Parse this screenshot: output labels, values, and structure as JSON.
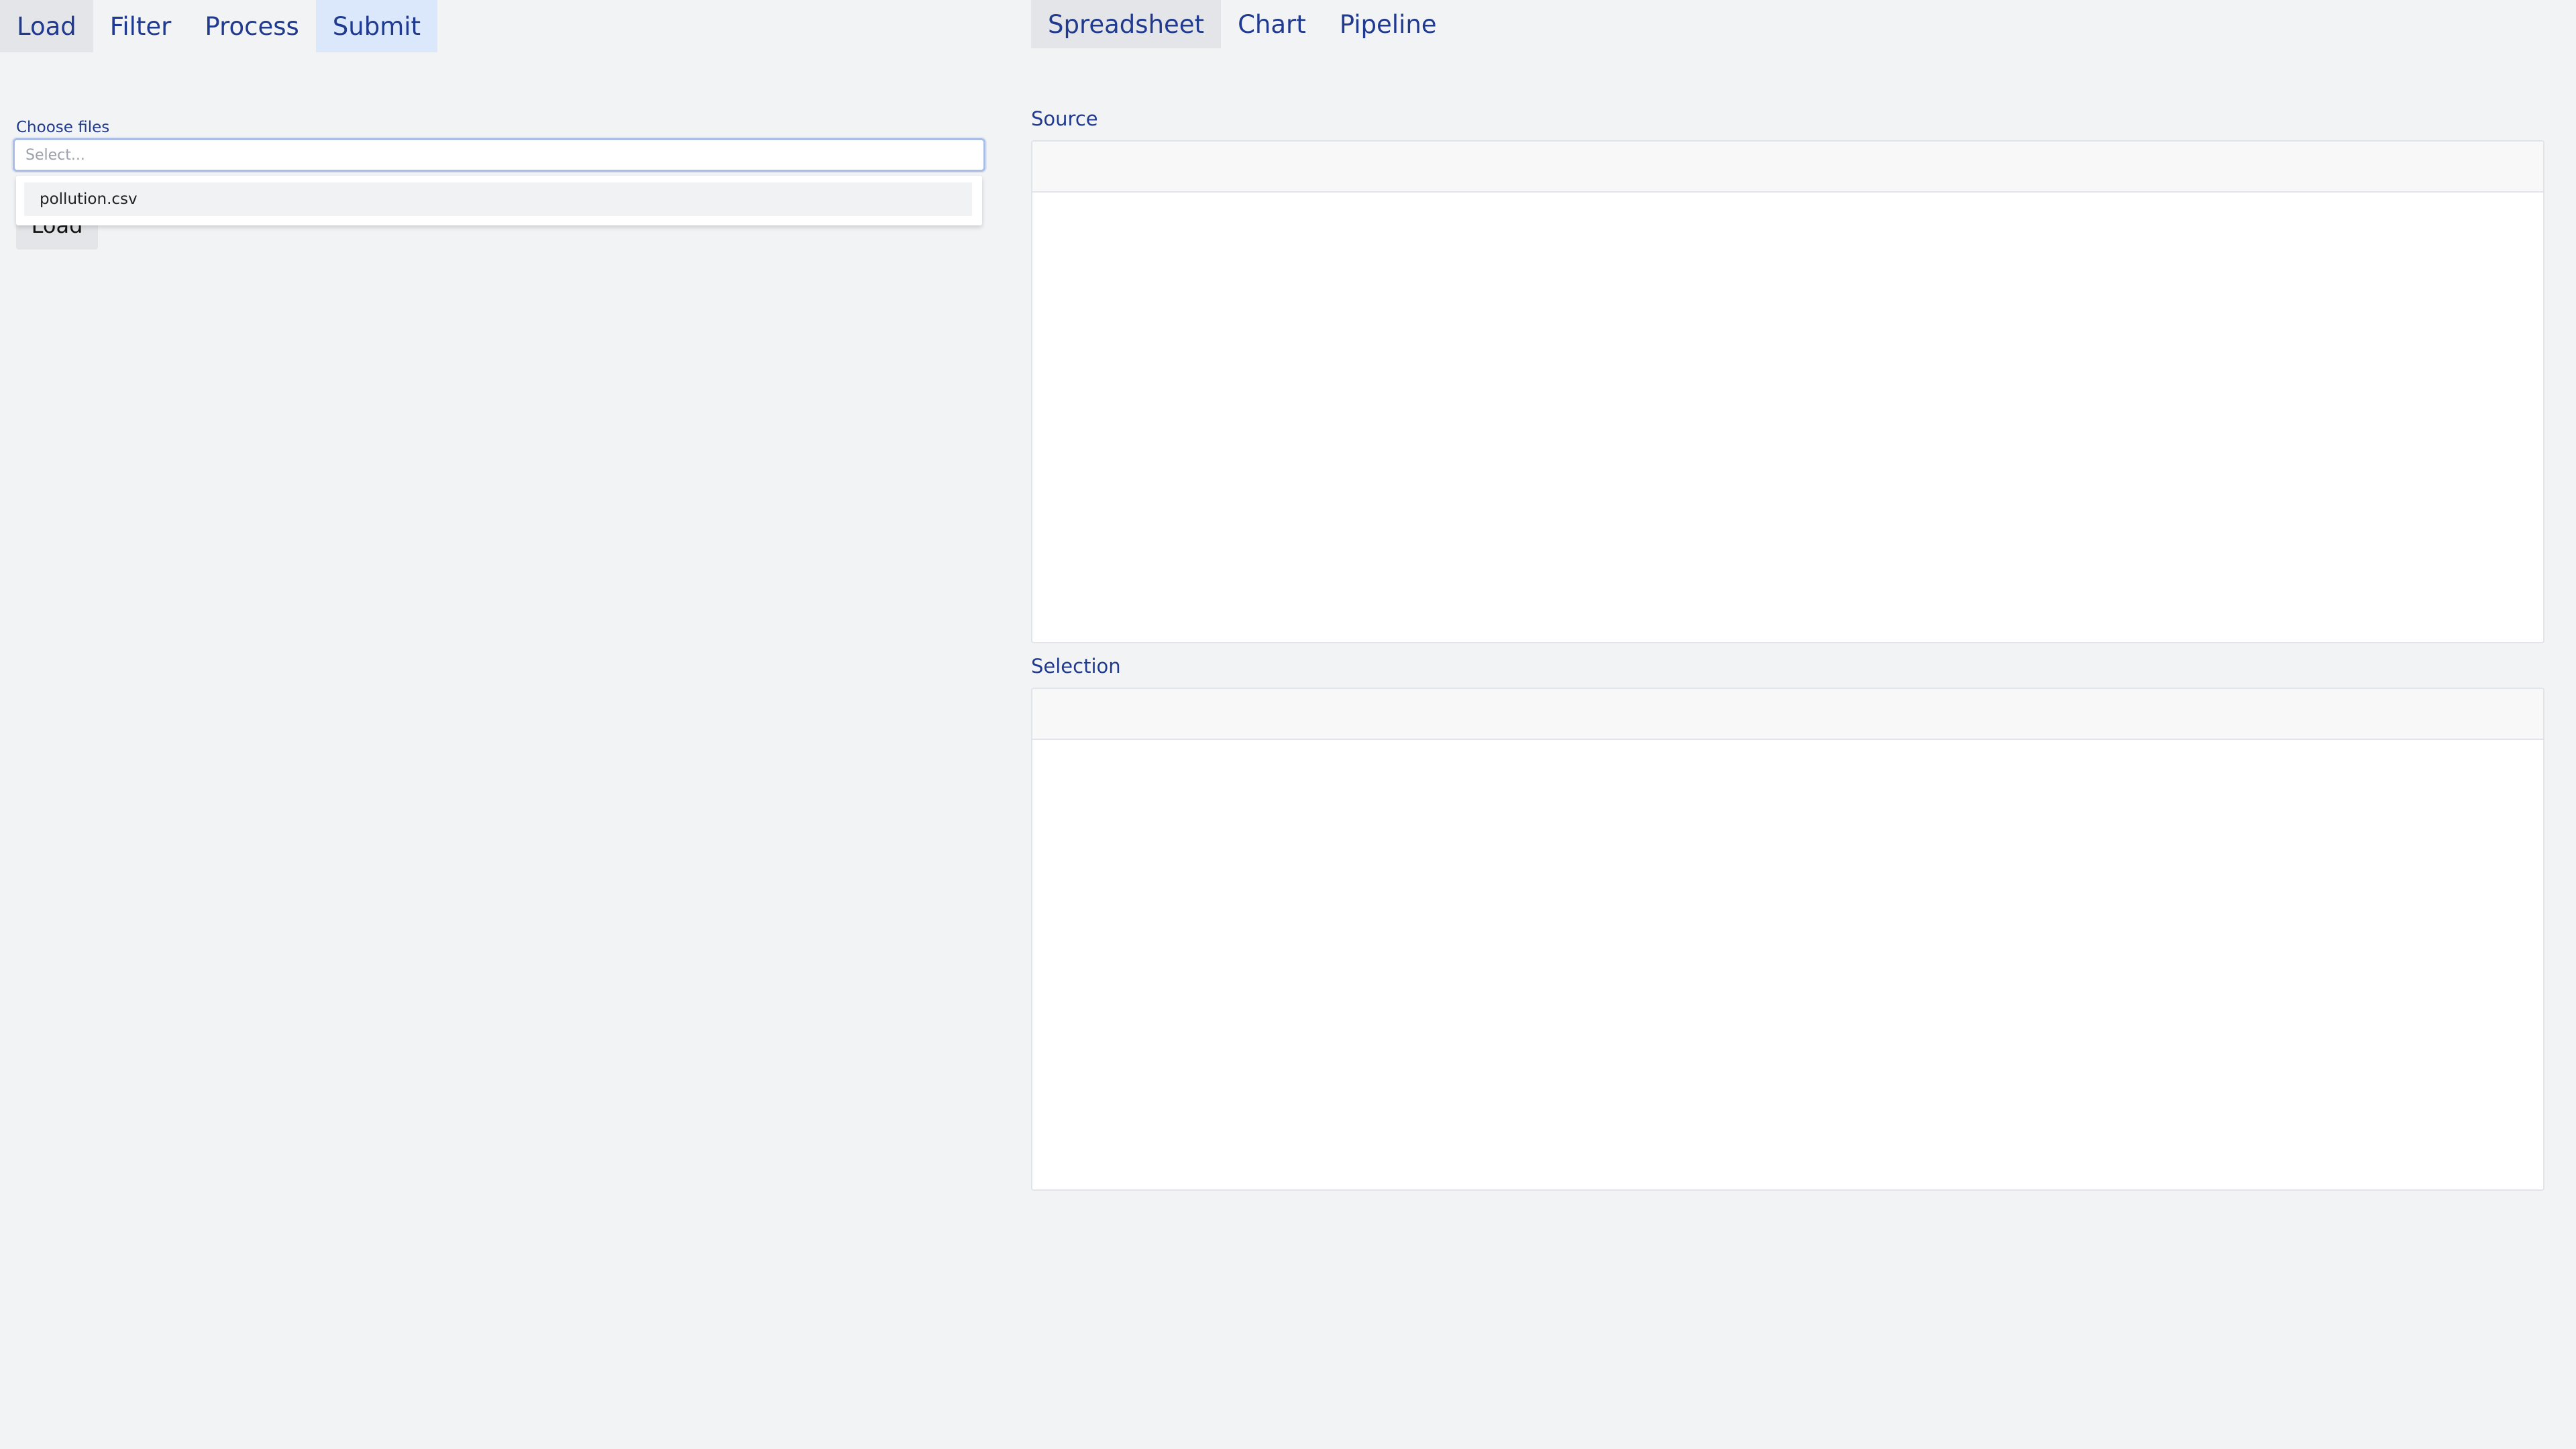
{
  "left_tabs": {
    "load": "Load",
    "filter": "Filter",
    "process": "Process",
    "submit": "Submit"
  },
  "load_panel": {
    "file_label": "Choose files",
    "select_placeholder": "Select...",
    "dropdown_options": [
      "pollution.csv"
    ],
    "load_button_label": "Load"
  },
  "right_tabs": {
    "spreadsheet": "Spreadsheet",
    "chart": "Chart",
    "pipeline": "Pipeline"
  },
  "sections": {
    "source_label": "Source",
    "selection_label": "Selection"
  },
  "colors": {
    "accent_text": "#1f3a8f",
    "active_tab_grey": "#e3e5e8",
    "active_tab_blue": "#dbe8fb",
    "page_background": "#f2f3f5"
  }
}
